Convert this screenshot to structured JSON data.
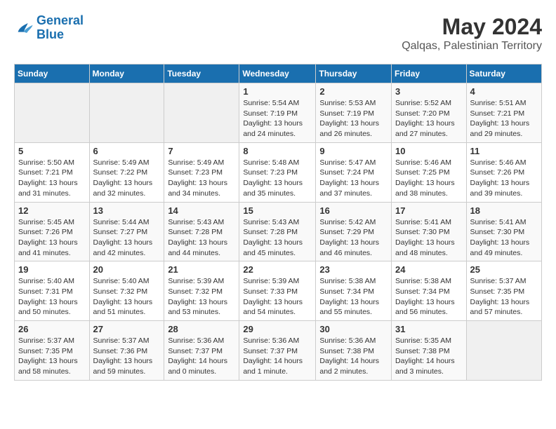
{
  "header": {
    "logo_line1": "General",
    "logo_line2": "Blue",
    "month_year": "May 2024",
    "location": "Qalqas, Palestinian Territory"
  },
  "weekdays": [
    "Sunday",
    "Monday",
    "Tuesday",
    "Wednesday",
    "Thursday",
    "Friday",
    "Saturday"
  ],
  "weeks": [
    [
      {
        "day": "",
        "info": ""
      },
      {
        "day": "",
        "info": ""
      },
      {
        "day": "",
        "info": ""
      },
      {
        "day": "1",
        "info": "Sunrise: 5:54 AM\nSunset: 7:19 PM\nDaylight: 13 hours\nand 24 minutes."
      },
      {
        "day": "2",
        "info": "Sunrise: 5:53 AM\nSunset: 7:19 PM\nDaylight: 13 hours\nand 26 minutes."
      },
      {
        "day": "3",
        "info": "Sunrise: 5:52 AM\nSunset: 7:20 PM\nDaylight: 13 hours\nand 27 minutes."
      },
      {
        "day": "4",
        "info": "Sunrise: 5:51 AM\nSunset: 7:21 PM\nDaylight: 13 hours\nand 29 minutes."
      }
    ],
    [
      {
        "day": "5",
        "info": "Sunrise: 5:50 AM\nSunset: 7:21 PM\nDaylight: 13 hours\nand 31 minutes."
      },
      {
        "day": "6",
        "info": "Sunrise: 5:49 AM\nSunset: 7:22 PM\nDaylight: 13 hours\nand 32 minutes."
      },
      {
        "day": "7",
        "info": "Sunrise: 5:49 AM\nSunset: 7:23 PM\nDaylight: 13 hours\nand 34 minutes."
      },
      {
        "day": "8",
        "info": "Sunrise: 5:48 AM\nSunset: 7:23 PM\nDaylight: 13 hours\nand 35 minutes."
      },
      {
        "day": "9",
        "info": "Sunrise: 5:47 AM\nSunset: 7:24 PM\nDaylight: 13 hours\nand 37 minutes."
      },
      {
        "day": "10",
        "info": "Sunrise: 5:46 AM\nSunset: 7:25 PM\nDaylight: 13 hours\nand 38 minutes."
      },
      {
        "day": "11",
        "info": "Sunrise: 5:46 AM\nSunset: 7:26 PM\nDaylight: 13 hours\nand 39 minutes."
      }
    ],
    [
      {
        "day": "12",
        "info": "Sunrise: 5:45 AM\nSunset: 7:26 PM\nDaylight: 13 hours\nand 41 minutes."
      },
      {
        "day": "13",
        "info": "Sunrise: 5:44 AM\nSunset: 7:27 PM\nDaylight: 13 hours\nand 42 minutes."
      },
      {
        "day": "14",
        "info": "Sunrise: 5:43 AM\nSunset: 7:28 PM\nDaylight: 13 hours\nand 44 minutes."
      },
      {
        "day": "15",
        "info": "Sunrise: 5:43 AM\nSunset: 7:28 PM\nDaylight: 13 hours\nand 45 minutes."
      },
      {
        "day": "16",
        "info": "Sunrise: 5:42 AM\nSunset: 7:29 PM\nDaylight: 13 hours\nand 46 minutes."
      },
      {
        "day": "17",
        "info": "Sunrise: 5:41 AM\nSunset: 7:30 PM\nDaylight: 13 hours\nand 48 minutes."
      },
      {
        "day": "18",
        "info": "Sunrise: 5:41 AM\nSunset: 7:30 PM\nDaylight: 13 hours\nand 49 minutes."
      }
    ],
    [
      {
        "day": "19",
        "info": "Sunrise: 5:40 AM\nSunset: 7:31 PM\nDaylight: 13 hours\nand 50 minutes."
      },
      {
        "day": "20",
        "info": "Sunrise: 5:40 AM\nSunset: 7:32 PM\nDaylight: 13 hours\nand 51 minutes."
      },
      {
        "day": "21",
        "info": "Sunrise: 5:39 AM\nSunset: 7:32 PM\nDaylight: 13 hours\nand 53 minutes."
      },
      {
        "day": "22",
        "info": "Sunrise: 5:39 AM\nSunset: 7:33 PM\nDaylight: 13 hours\nand 54 minutes."
      },
      {
        "day": "23",
        "info": "Sunrise: 5:38 AM\nSunset: 7:34 PM\nDaylight: 13 hours\nand 55 minutes."
      },
      {
        "day": "24",
        "info": "Sunrise: 5:38 AM\nSunset: 7:34 PM\nDaylight: 13 hours\nand 56 minutes."
      },
      {
        "day": "25",
        "info": "Sunrise: 5:37 AM\nSunset: 7:35 PM\nDaylight: 13 hours\nand 57 minutes."
      }
    ],
    [
      {
        "day": "26",
        "info": "Sunrise: 5:37 AM\nSunset: 7:35 PM\nDaylight: 13 hours\nand 58 minutes."
      },
      {
        "day": "27",
        "info": "Sunrise: 5:37 AM\nSunset: 7:36 PM\nDaylight: 13 hours\nand 59 minutes."
      },
      {
        "day": "28",
        "info": "Sunrise: 5:36 AM\nSunset: 7:37 PM\nDaylight: 14 hours\nand 0 minutes."
      },
      {
        "day": "29",
        "info": "Sunrise: 5:36 AM\nSunset: 7:37 PM\nDaylight: 14 hours\nand 1 minute."
      },
      {
        "day": "30",
        "info": "Sunrise: 5:36 AM\nSunset: 7:38 PM\nDaylight: 14 hours\nand 2 minutes."
      },
      {
        "day": "31",
        "info": "Sunrise: 5:35 AM\nSunset: 7:38 PM\nDaylight: 14 hours\nand 3 minutes."
      },
      {
        "day": "",
        "info": ""
      }
    ]
  ]
}
